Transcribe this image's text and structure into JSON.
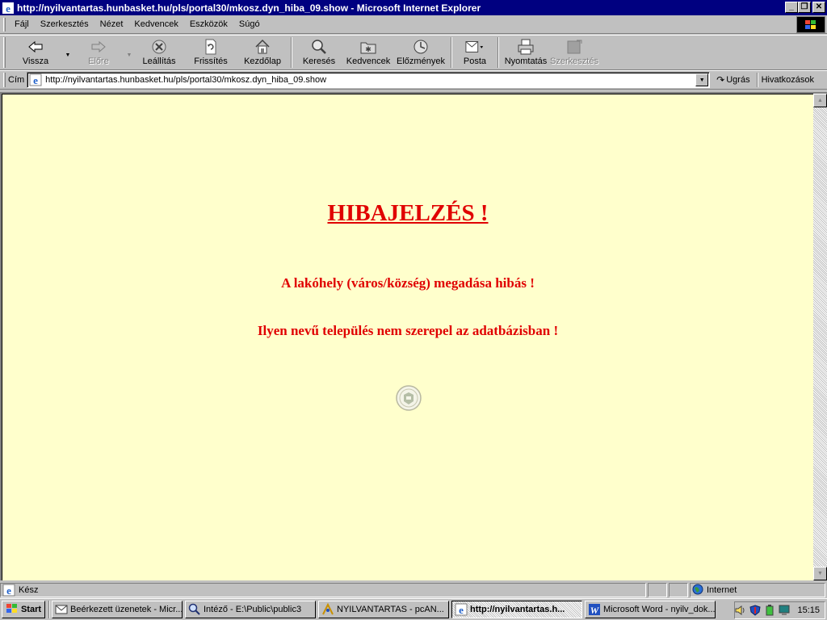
{
  "window": {
    "title": "http://nyilvantartas.hunbasket.hu/pls/portal30/mkosz.dyn_hiba_09.show - Microsoft Internet Explorer"
  },
  "menu": {
    "items": [
      {
        "label": "Fájl"
      },
      {
        "label": "Szerkesztés"
      },
      {
        "label": "Nézet"
      },
      {
        "label": "Kedvencek"
      },
      {
        "label": "Eszközök"
      },
      {
        "label": "Súgó"
      }
    ]
  },
  "toolbar": {
    "back": "Vissza",
    "forward": "Előre",
    "stop": "Leállítás",
    "refresh": "Frissítés",
    "home": "Kezdőlap",
    "search": "Keresés",
    "favorites": "Kedvencek",
    "history": "Előzmények",
    "mail": "Posta",
    "print": "Nyomtatás",
    "edit": "Szerkesztés"
  },
  "address": {
    "label": "Cím",
    "url": "http://nyilvantartas.hunbasket.hu/pls/portal30/mkosz.dyn_hiba_09.show",
    "go": "Ugrás",
    "links": "Hivatkozások"
  },
  "page": {
    "title": "HIBAJELZÉS !",
    "line1": "A lakóhely (város/község) megadása hibás !",
    "line2": "Ilyen nevű település nem szerepel az adatbázisban !",
    "background": "#ffffcc",
    "text_color": "#e00000"
  },
  "status": {
    "text": "Kész",
    "zone": "Internet"
  },
  "taskbar": {
    "start": "Start",
    "tasks": [
      {
        "label": "Beérkezett üzenetek - Micr...",
        "icon": "mail-icon",
        "active": false
      },
      {
        "label": "Intéző - E:\\Public\\public3",
        "icon": "explorer-icon",
        "active": false
      },
      {
        "label": "NYILVANTARTAS - pcAN...",
        "icon": "pcanywhere-icon",
        "active": false
      },
      {
        "label": "http://nyilvantartas.h...",
        "icon": "ie-icon",
        "active": true
      },
      {
        "label": "Microsoft Word - nyilv_dok...",
        "icon": "word-icon",
        "active": false
      }
    ],
    "clock": "15:15"
  }
}
